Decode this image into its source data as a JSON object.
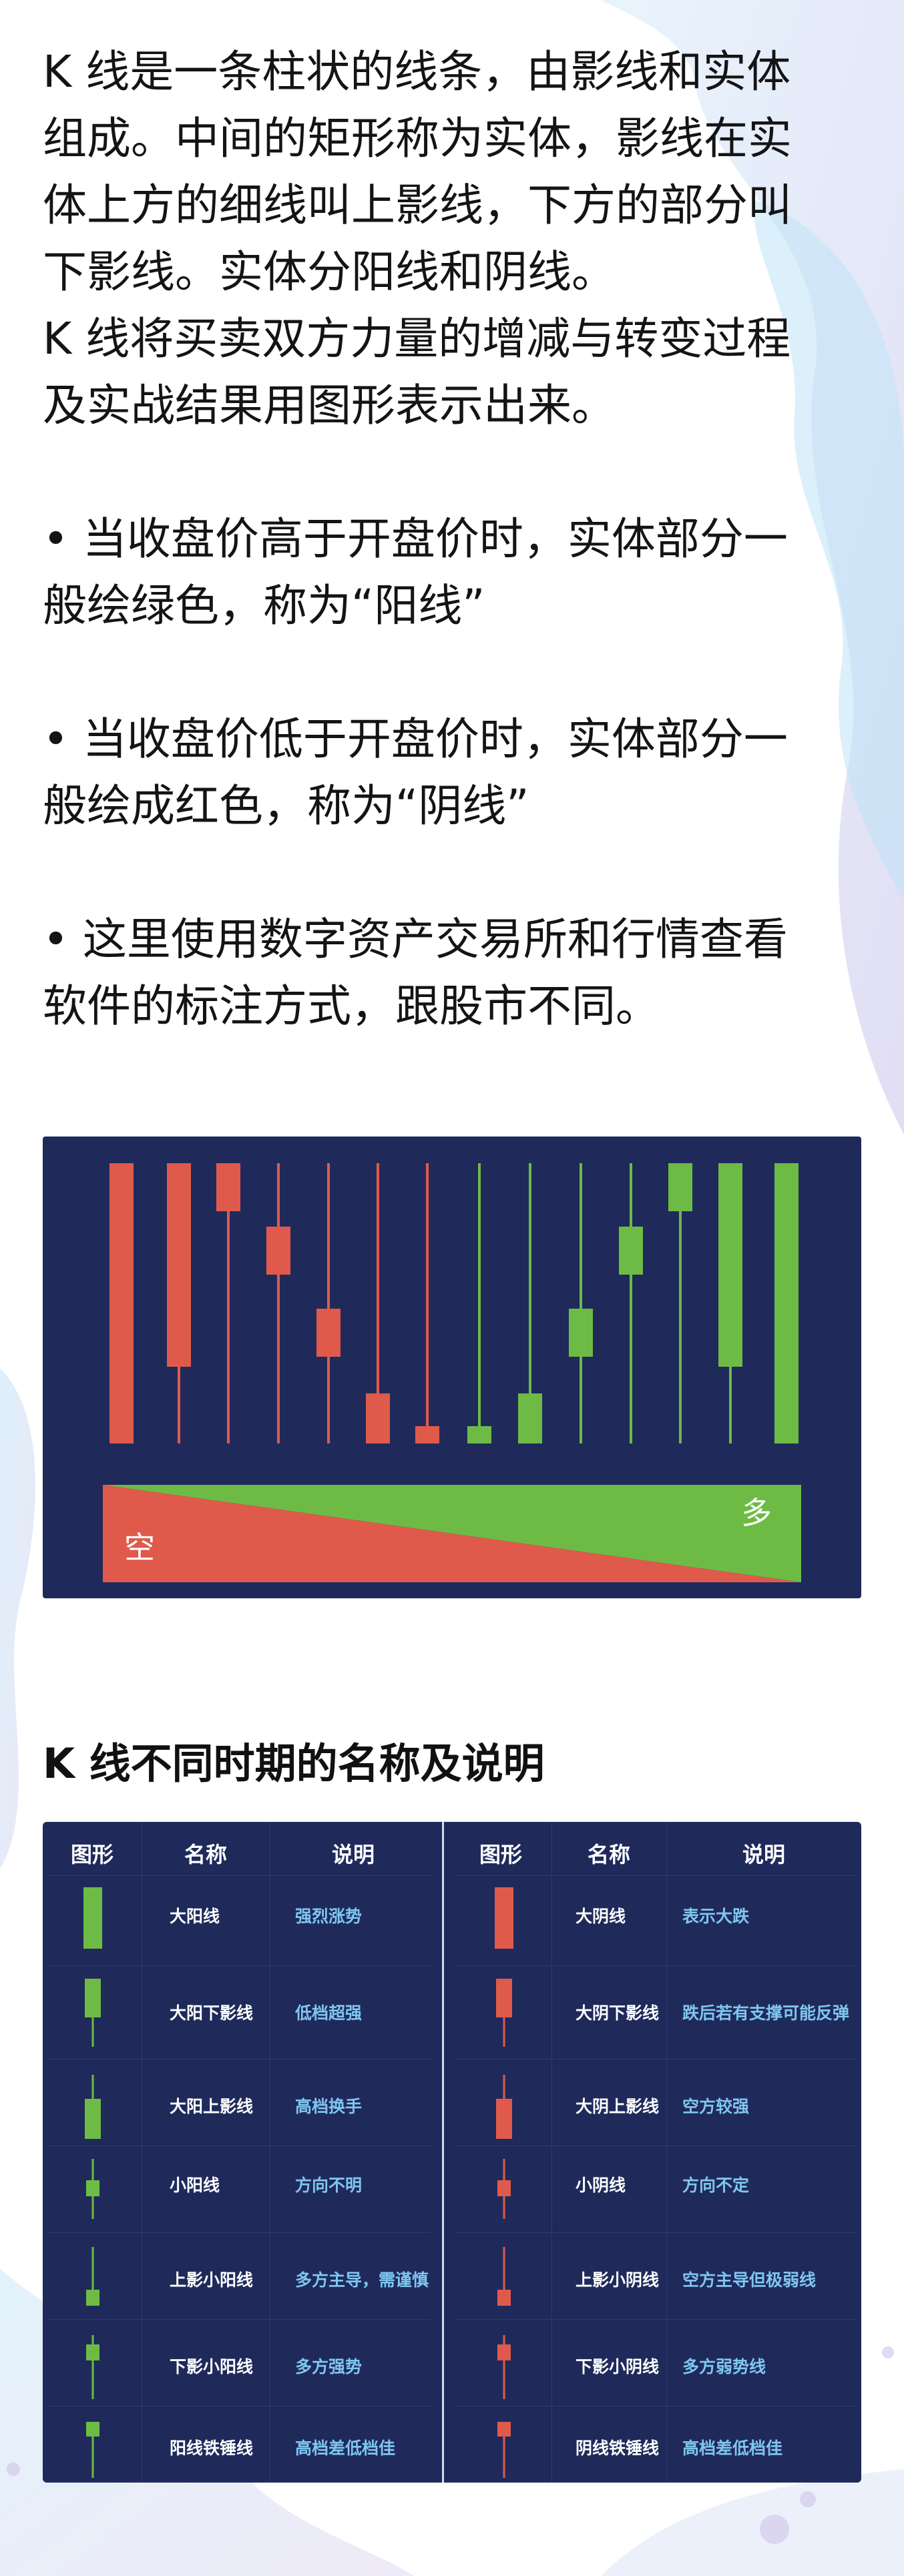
{
  "intro": {
    "lines": [
      "K 线是一条柱状的线条，由影线和实体",
      "组成。中间的矩形称为实体，影线在实",
      "体上方的细线叫上影线，下方的部分叫",
      "下影线。实体分阳线和阴线。",
      "K 线将买卖双方力量的增减与转变过程",
      "及实战结果用图形表示出来。"
    ],
    "bullet1": [
      "• 当收盘价高于开盘价时，实体部分一",
      "般绘绿色，称为“阳线”"
    ],
    "bullet2": [
      "• 当收盘价低于开盘价时，实体部分一",
      "般绘成红色，称为“阴线”"
    ],
    "bullet3": [
      "• 这里使用数字资产交易所和行情查看",
      "软件的标注方式，跟股市不同。"
    ]
  },
  "panel": {
    "label_left": "空",
    "label_right": "多",
    "colors": {
      "bg": "#1f2a5b",
      "red": "#e05a4c",
      "green": "#6dbb45"
    }
  },
  "section": {
    "title": "K 线不同时期的名称及说明"
  },
  "table": {
    "headers": [
      "图形",
      "名称",
      "说明"
    ],
    "left_rows": [
      {
        "name": "大阳线",
        "desc": "强烈涨势",
        "icon": "big-bull-candle-icon"
      },
      {
        "name": "大阳下影线",
        "desc": "低档超强",
        "icon": "bull-lower-shadow-candle-icon"
      },
      {
        "name": "大阳上影线",
        "desc": "高档换手",
        "icon": "bull-upper-shadow-candle-icon"
      },
      {
        "name": "小阳线",
        "desc": "方向不明",
        "icon": "small-bull-candle-icon"
      },
      {
        "name": "上影小阳线",
        "desc": "多方主导，需谨慎",
        "icon": "upper-shadow-small-bull-icon"
      },
      {
        "name": "下影小阳线",
        "desc": "多方强势",
        "icon": "lower-shadow-small-bull-icon"
      },
      {
        "name": "阳线铁锤线",
        "desc": "高档差低档佳",
        "icon": "bull-hammer-icon"
      }
    ],
    "right_rows": [
      {
        "name": "大阴线",
        "desc": "表示大跌",
        "icon": "big-bear-candle-icon"
      },
      {
        "name": "大阴下影线",
        "desc": "跌后若有支撑可能反弹",
        "icon": "bear-lower-shadow-candle-icon"
      },
      {
        "name": "大阴上影线",
        "desc": "空方较强",
        "icon": "bear-upper-shadow-candle-icon"
      },
      {
        "name": "小阴线",
        "desc": "方向不定",
        "icon": "small-bear-candle-icon"
      },
      {
        "name": "上影小阴线",
        "desc": "空方主导但极弱线",
        "icon": "upper-shadow-small-bear-icon"
      },
      {
        "name": "下影小阴线",
        "desc": "多方弱势线",
        "icon": "lower-shadow-small-bear-icon"
      },
      {
        "name": "阴线铁锤线",
        "desc": "高档差低档佳",
        "icon": "bear-hammer-icon"
      }
    ]
  }
}
